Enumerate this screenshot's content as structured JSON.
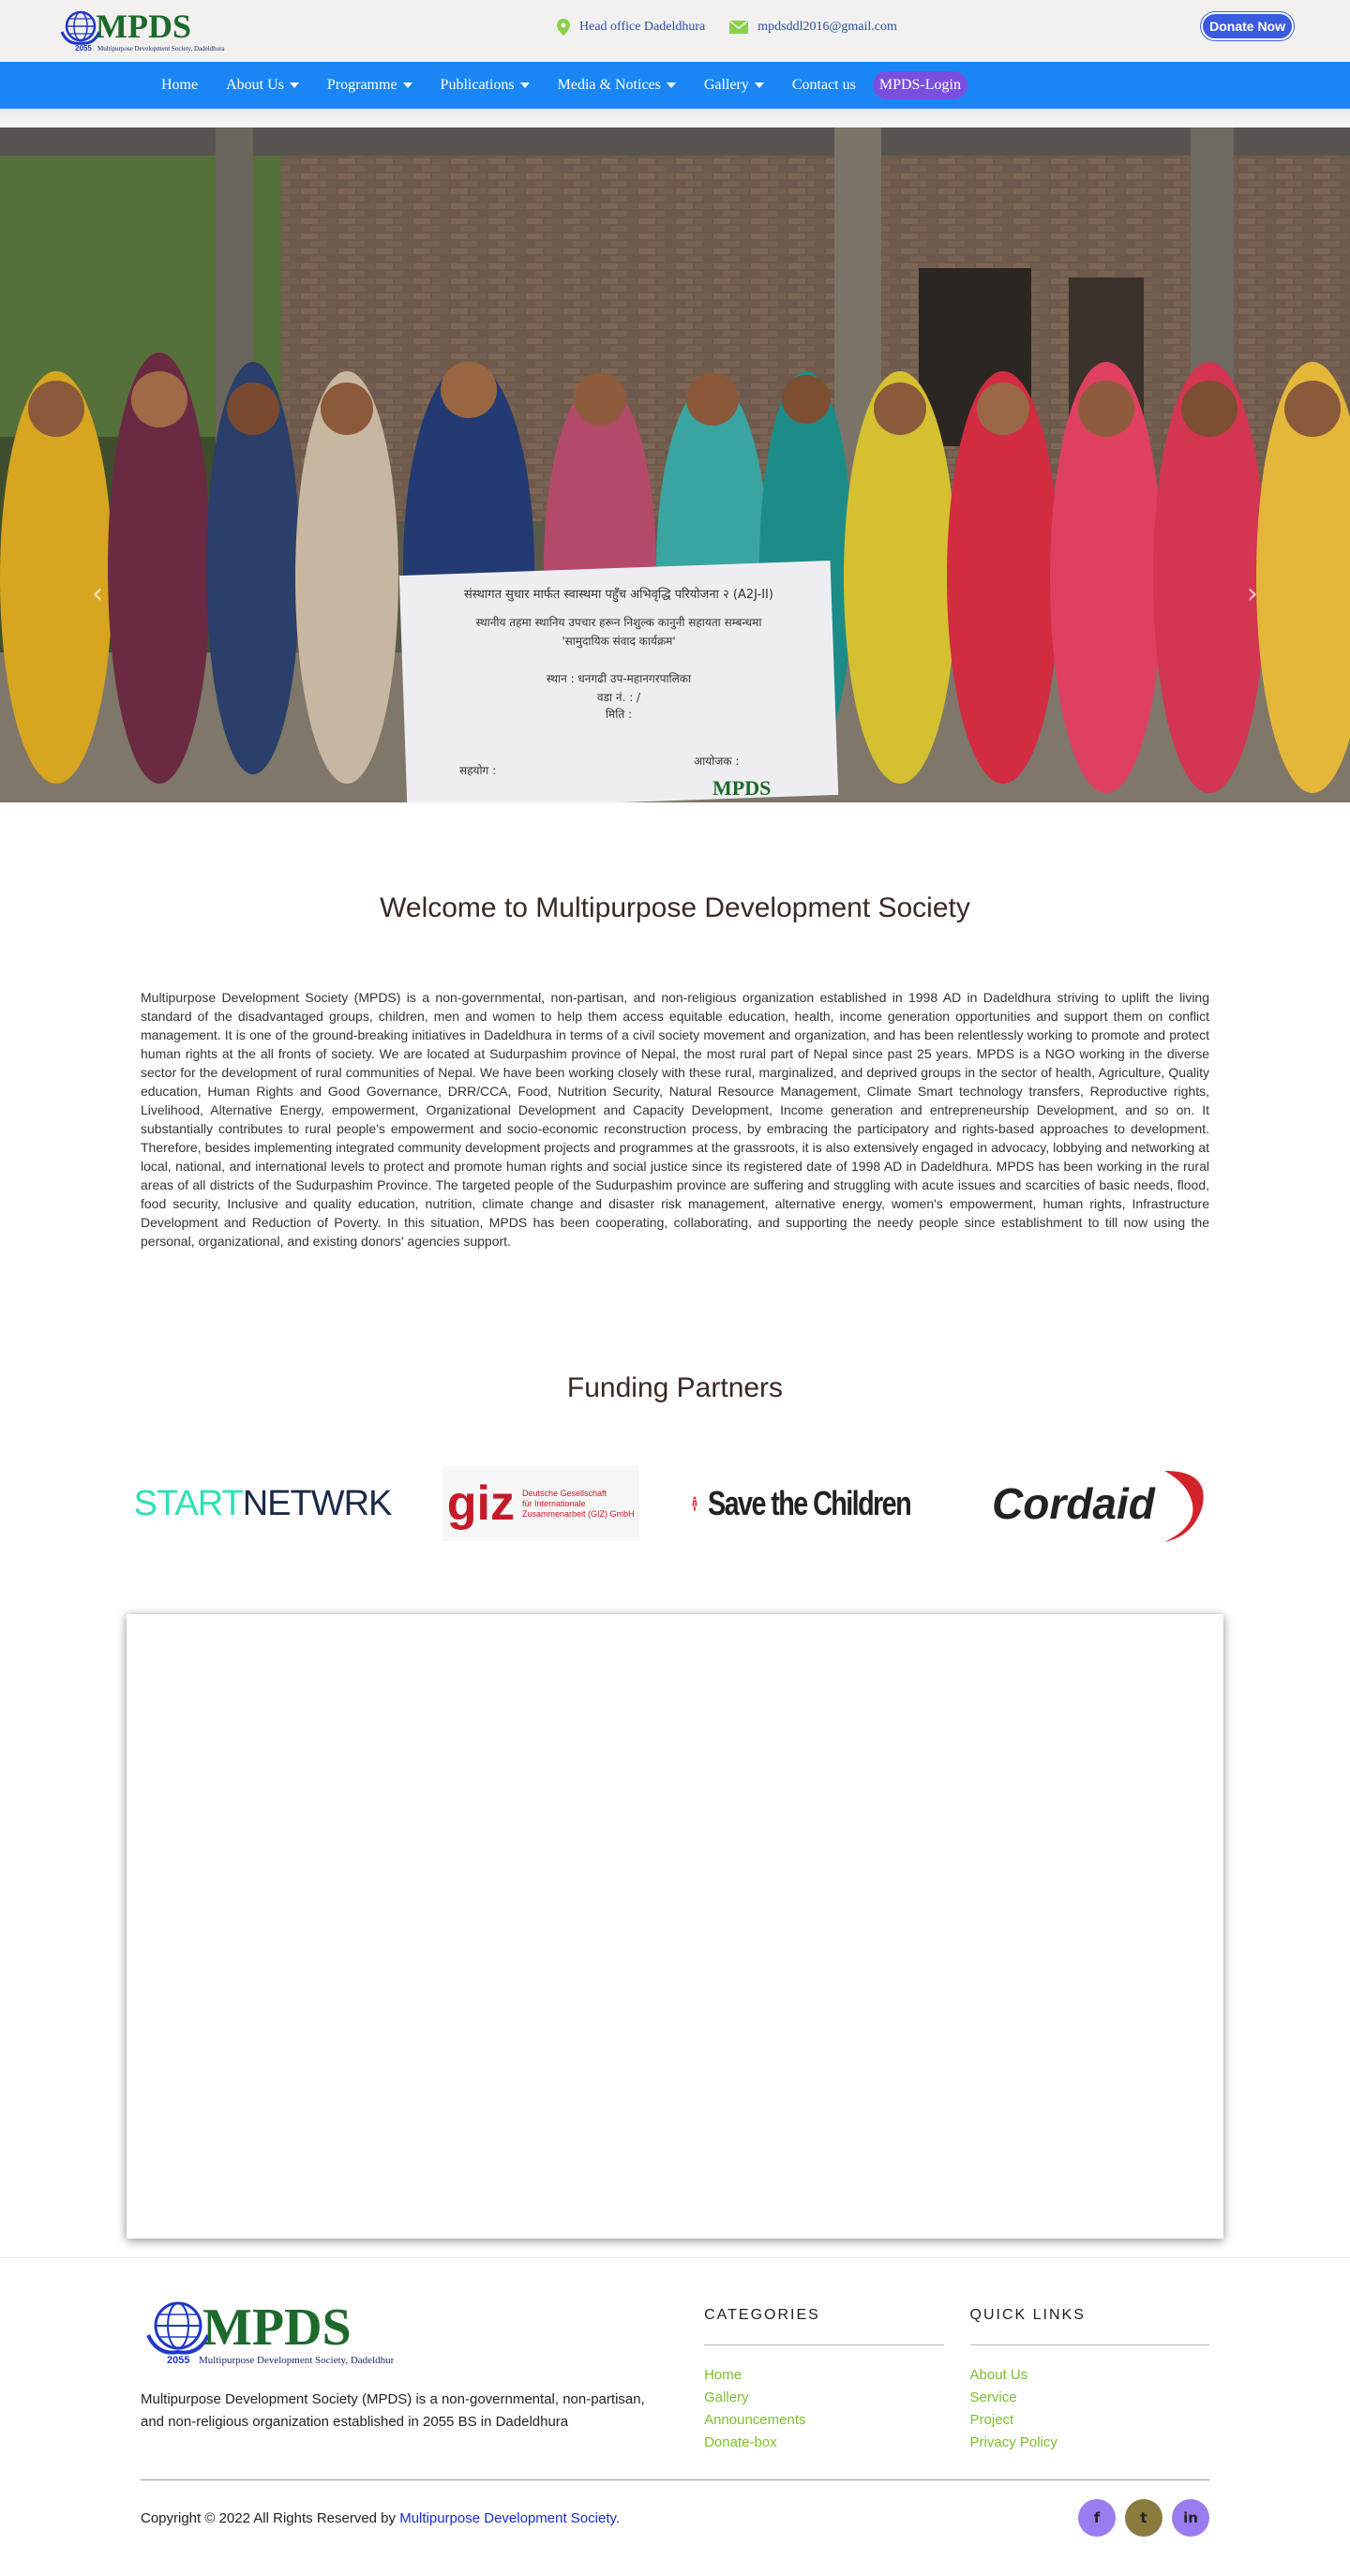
{
  "header": {
    "logo_text": "MPDS",
    "logo_year": "2055",
    "logo_subtitle": "Multipurpose Development Society, Dadeldhura",
    "address": "Head office Dadeldhura",
    "email": "mpdsddl2016@gmail.com",
    "donate_label": "Donate Now"
  },
  "nav": {
    "items": [
      {
        "label": "Home",
        "dropdown": false
      },
      {
        "label": "About Us",
        "dropdown": true
      },
      {
        "label": "Programme",
        "dropdown": true
      },
      {
        "label": "Publications",
        "dropdown": true
      },
      {
        "label": "Media & Notices",
        "dropdown": true
      },
      {
        "label": "Gallery",
        "dropdown": true
      },
      {
        "label": "Contact us",
        "dropdown": false
      }
    ],
    "login_label": "MPDS-Login"
  },
  "hero": {
    "banner_line1": "संस्थागत सुधार मार्फत स्वास्थमा पहुँच अभिवृद्धि परियोजना २ (A2J-II)",
    "banner_line2": "स्थानीय तहमा स्थानिय उपचार हरून निशुल्क कानुनी सहायता सम्बन्धमा",
    "banner_line3": "'सामुदायिक संवाद कार्यक्रम'",
    "banner_line4": "स्थान : धनगढी उप-महानगरपालिका",
    "banner_line5": "वडा नं. : /",
    "banner_line6": "मिति :",
    "banner_left": "सहयोग :",
    "banner_right": "आयोजक :",
    "banner_logo": "MPDS",
    "prev_icon": "‹",
    "next_icon": "›"
  },
  "welcome": {
    "title": "Welcome to Multipurpose Development Society",
    "body": "Multipurpose Development Society (MPDS) is a non-governmental, non-partisan, and non-religious organization established in 1998 AD in Dadeldhura striving to uplift the living standard of the disadvantaged groups, children, men and women to help them access equitable education, health, income generation opportunities and support them on conflict management. It is one of the ground-breaking initiatives in Dadeldhura in terms of a civil society movement and organization, and has been relentlessly working to promote and protect human rights at the all fronts of society. We are located at Sudurpashim province of Nepal, the most rural part of Nepal since past 25 years. MPDS is a NGO working in the diverse sector for the development of rural communities of Nepal. We have been working closely with these rural, marginalized, and deprived groups in the sector of health, Agriculture, Quality education, Human Rights and Good Governance, DRR/CCA, Food, Nutrition Security, Natural Resource Management, Climate Smart technology transfers, Reproductive rights, Livelihood, Alternative Energy, empowerment, Organizational Development and Capacity Development, Income generation and entrepreneurship Development, and so on. It substantially contributes to rural people's empowerment and socio-economic reconstruction process, by embracing the participatory and rights-based approaches to development. Therefore, besides implementing integrated community development projects and programmes at the grassroots, it is also extensively engaged in advocacy, lobbying and networking at local, national, and international levels to protect and promote human rights and social justice since its registered date of 1998 AD in Dadeldhura. MPDS has been working in the rural areas of all districts of the Sudurpashim Province. The targeted people of the Sudurpashim province are suffering and struggling with acute issues and scarcities of basic needs, flood, food security, Inclusive and quality education, nutrition, climate change and disaster risk management, alternative energy, women's empowerment, human rights, Infrastructure Development and Reduction of Poverty. In this situation, MPDS has been cooperating, collaborating, and supporting the needy people since establishment to till now using the personal, organizational, and existing donors' agencies support."
  },
  "partners": {
    "title": "Funding Partners",
    "start_a": "START",
    "start_b": "NETW",
    "start_c": "RK",
    "giz_mark": "giz",
    "giz_line1": "Deutsche Gesellschaft",
    "giz_line2": "für Internationale",
    "giz_line3": "Zusammenarbeit (GIZ) GmbH",
    "savethechildren": "Save the Children",
    "cordaid": "Cordaid"
  },
  "footer": {
    "about": "Multipurpose Development Society (MPDS) is a non-governmental, non-partisan, and non-religious organization established in 2055 BS in Dadeldhura",
    "categories_title": "CATEGORIES",
    "categories": [
      "Home",
      "Gallery",
      "Announcements",
      "Donate-box"
    ],
    "quicklinks_title": "QUICK LINKS",
    "quicklinks": [
      "About Us",
      "Service",
      "Project",
      "Privacy Policy"
    ],
    "copyright": "Copyright © 2022 All Rights Reserved by",
    "copyright_link": "Multipurpose Development Society.",
    "social": [
      {
        "icon": "facebook-icon",
        "glyph": "f",
        "color": "#9b7bf0"
      },
      {
        "icon": "twitter-icon",
        "glyph": "t",
        "color": "#8a7a3e"
      },
      {
        "icon": "linkedin-icon",
        "glyph": "in",
        "color": "#9b7bf0"
      }
    ]
  },
  "colors": {
    "nav_bg": "#1a86f5",
    "donate_bg": "#3b5ce0",
    "login_bg": "#7a4fe0",
    "footer_link": "#7cbf2a"
  }
}
